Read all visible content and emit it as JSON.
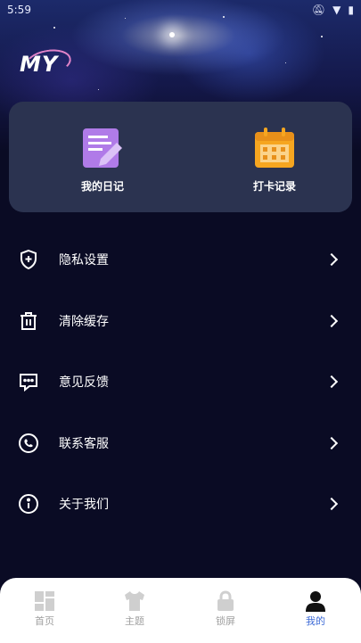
{
  "status_bar": {
    "time": "5:59"
  },
  "header": {
    "logo_text": "MY"
  },
  "cards": {
    "diary_label": "我的日记",
    "checkin_label": "打卡记录"
  },
  "menu": [
    {
      "label": "隐私设置",
      "icon": "shield-plus-icon"
    },
    {
      "label": "清除缓存",
      "icon": "trash-icon"
    },
    {
      "label": "意见反馈",
      "icon": "chat-bubble-icon"
    },
    {
      "label": "联系客服",
      "icon": "phone-icon"
    },
    {
      "label": "关于我们",
      "icon": "info-icon"
    }
  ],
  "nav": {
    "home": "首页",
    "theme": "主题",
    "lock": "锁屏",
    "mine": "我的",
    "active_color": "#3d6ad6",
    "inactive_color": "#a0a0a0"
  }
}
